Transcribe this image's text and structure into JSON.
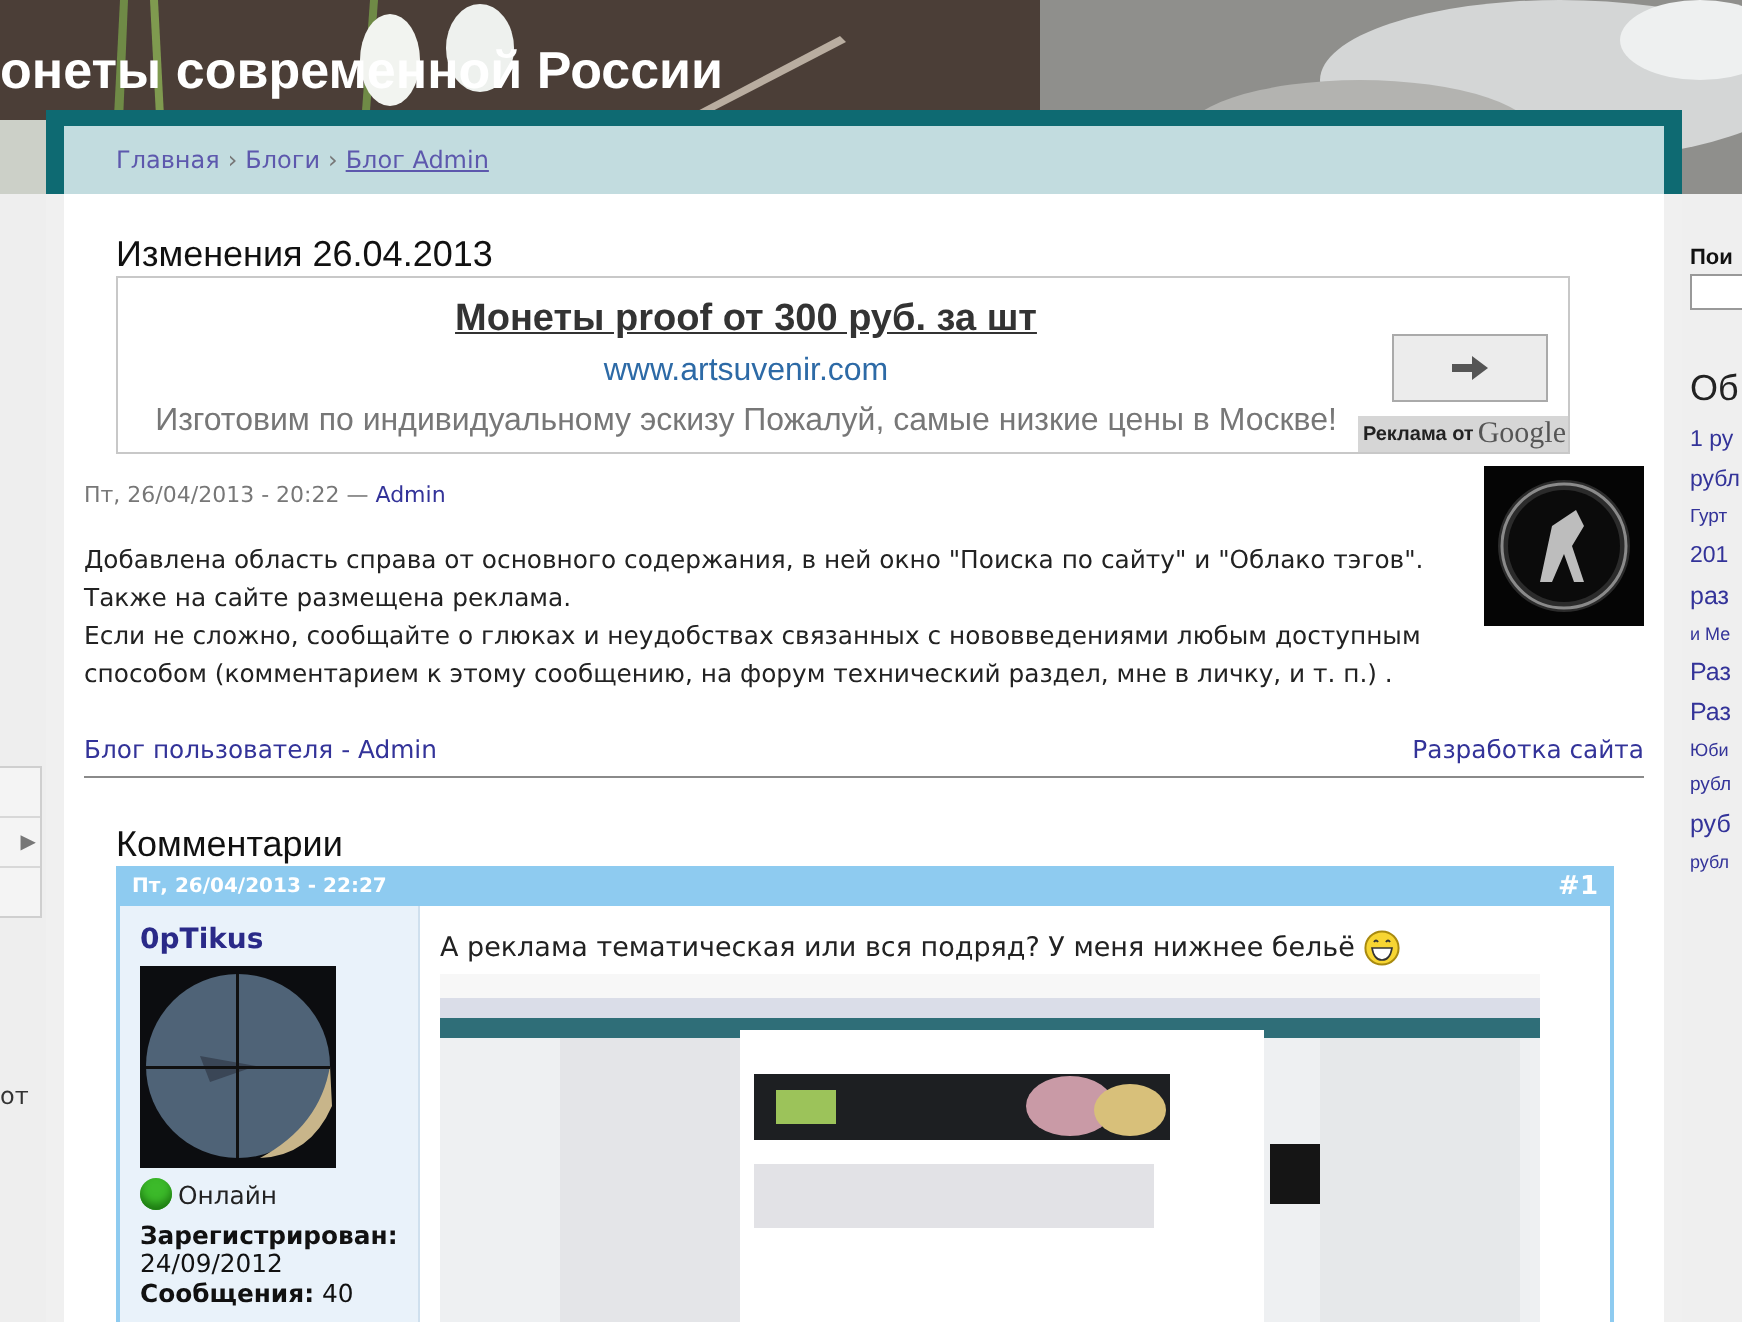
{
  "site_title": "онеты современной России",
  "breadcrumb": [
    {
      "kind": "link",
      "label": "Главная"
    },
    {
      "kind": "separator",
      "label": "›"
    },
    {
      "kind": "link",
      "label": "Блоги"
    },
    {
      "kind": "separator",
      "label": "›"
    },
    {
      "kind": "current",
      "label": "Блог Admin"
    }
  ],
  "left_sidebar": {
    "menu_rows": [
      {
        "kind": "plain"
      },
      {
        "kind": "submenu",
        "arrow": "▶"
      },
      {
        "kind": "plain"
      }
    ],
    "fragment": "от"
  },
  "right_sidebar": {
    "search_label": "Пои",
    "heading": "Об",
    "tags": [
      {
        "text": "1 ру",
        "kind": "large"
      },
      {
        "text": "рубл",
        "kind": "large"
      },
      {
        "text": "Гурт",
        "kind": "small"
      },
      {
        "text": "201",
        "kind": "large"
      },
      {
        "text": "раз",
        "kind": "xlarge"
      },
      {
        "text": "и Ме",
        "kind": "tiny"
      },
      {
        "text": "Раз",
        "kind": "xlarge"
      },
      {
        "text": "Раз",
        "kind": "xlarge"
      },
      {
        "text": "Юби",
        "kind": "tiny"
      },
      {
        "text": "рубл",
        "kind": "small"
      },
      {
        "text": "руб",
        "kind": "xlarge"
      },
      {
        "text": "рубл",
        "kind": "tiny"
      }
    ]
  },
  "post": {
    "title": "Изменения 26.04.2013",
    "ad": {
      "headline": "Монеты proof от 300 руб. за шт",
      "url": "www.artsuvenir.com",
      "description": "Изготовим по индивидуальному эскизу Пожалуй, самые низкие цены в Москве!",
      "label_prefix": "Реклама от",
      "label_brand": "Google"
    },
    "date": "Пт, 26/04/2013 - 20:22 — ",
    "author": "Admin",
    "paragraphs": [
      "Добавлена область справа от основного содержания, в ней окно \"Поиска по сайту\" и \"Облако тэгов\".",
      "Также на сайте размещена реклама.",
      "Если не сложно, сообщайте о глюках и неудобствах связанных с нововведениями любым доступным способом (комментарием к этому сообщению, на форум технический раздел, мне в личку, и т. п.) ."
    ],
    "blog_link": "Блог пользователя - Admin",
    "dev_link": "Разработка сайта"
  },
  "comments": {
    "heading": "Комментарии",
    "items": [
      {
        "date": "Пт, 26/04/2013 - 22:27",
        "number": "#1",
        "author": "0pTikus",
        "online": true,
        "online_label": "Онлайн",
        "registered_label": "Зарегистрирован:",
        "registered": "24/09/2012",
        "posts_label": "Сообщения:",
        "posts": "40",
        "text": "А реклама тематическая или вся подряд? У меня нижнее бельё"
      }
    ]
  }
}
